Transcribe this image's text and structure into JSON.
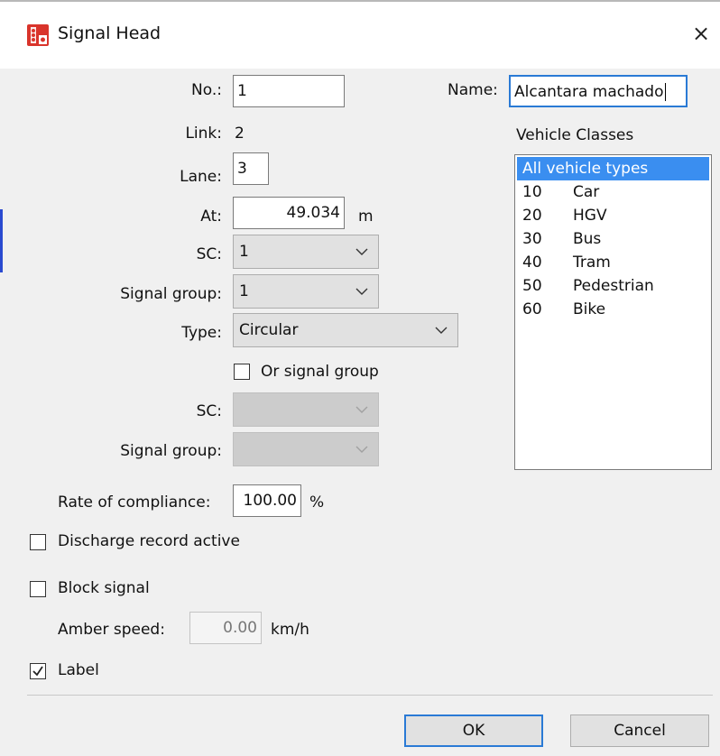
{
  "title": "Signal Head",
  "close_icon": "×",
  "fields": {
    "no_label": "No.:",
    "no_value": "1",
    "link_label": "Link:",
    "link_value": "2",
    "lane_label": "Lane:",
    "lane_value": "3",
    "at_label": "At:",
    "at_value": "49.034",
    "at_unit": "m",
    "sc_label": "SC:",
    "sc_value": "1",
    "signal_group_label": "Signal group:",
    "signal_group_value": "1",
    "type_label": "Type:",
    "type_value": "Circular",
    "or_signal_group_label": "Or signal group",
    "or_signal_group_checked": false,
    "sc2_label": "SC:",
    "sc2_value": "",
    "signal_group2_label": "Signal group:",
    "signal_group2_value": "",
    "rate_label": "Rate of compliance:",
    "rate_value": "100.00",
    "rate_unit": "%",
    "discharge_label": "Discharge record active",
    "discharge_checked": false,
    "block_signal_label": "Block signal",
    "block_signal_checked": false,
    "amber_speed_label": "Amber speed:",
    "amber_speed_value": "0.00",
    "amber_speed_unit": "km/h",
    "label_label": "Label",
    "label_checked": true
  },
  "name": {
    "label": "Name:",
    "value": "Alcantara machado"
  },
  "vehicle_classes": {
    "label": "Vehicle Classes",
    "items": [
      {
        "code": "",
        "name": "All vehicle types",
        "selected": true
      },
      {
        "code": "10",
        "name": "Car"
      },
      {
        "code": "20",
        "name": "HGV"
      },
      {
        "code": "30",
        "name": "Bus"
      },
      {
        "code": "40",
        "name": "Tram"
      },
      {
        "code": "50",
        "name": "Pedestrian"
      },
      {
        "code": "60",
        "name": "Bike"
      }
    ]
  },
  "buttons": {
    "ok": "OK",
    "cancel": "Cancel"
  },
  "colors": {
    "selection": "#3a8ef0",
    "focus_border": "#2a7ad5",
    "icon_red": "#d9342b"
  }
}
